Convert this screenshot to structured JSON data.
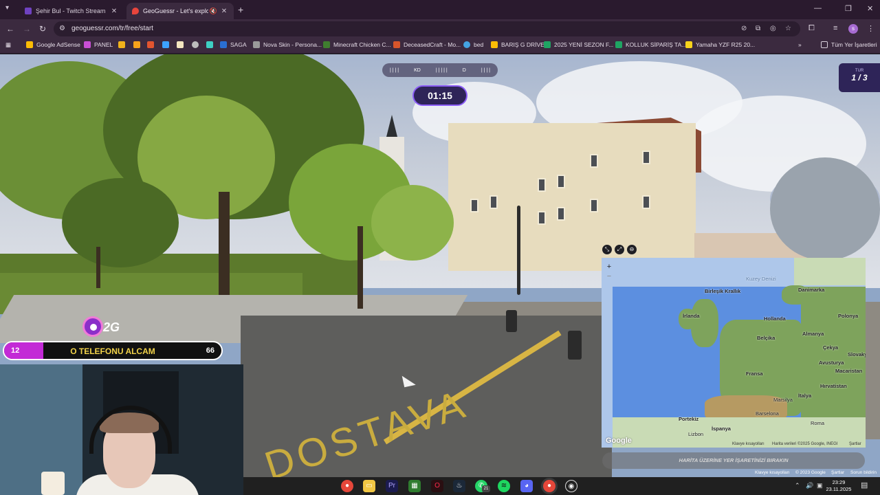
{
  "browser": {
    "tabs": [
      {
        "title": "Şehir Bul - Twitch Stream Games",
        "active": false,
        "color": "#6f42c1"
      },
      {
        "title": "GeoGuessr - Let's explore the world!",
        "active": true,
        "color": "#e8453c"
      }
    ],
    "new_tab": "+",
    "url": "geoguessr.com/tr/free/start",
    "profile_initial": "s"
  },
  "bookmarks": [
    {
      "label": "Google AdSense",
      "color": "#fbbc05"
    },
    {
      "label": "PANEL",
      "color": "#c94fd6"
    },
    {
      "label": "",
      "color": "#f1b21b"
    },
    {
      "label": "",
      "color": "#f7a21b"
    },
    {
      "label": "",
      "color": "#e2552f"
    },
    {
      "label": "",
      "color": "#3ca2ff"
    },
    {
      "label": "",
      "color": "#f4e6c0"
    },
    {
      "label": "",
      "color": "#bdbdbd"
    },
    {
      "label": "",
      "color": "#3ed0c3"
    },
    {
      "label": "SAGA",
      "color": "#2a6fd1"
    },
    {
      "label": "Nova Skin - Persona...",
      "color": "#9a9a9a"
    },
    {
      "label": "Minecraft Chicken C...",
      "color": "#3f7e2f"
    },
    {
      "label": "DeceasedCraft - Mo...",
      "color": "#d8552b"
    },
    {
      "label": "bed",
      "color": "#44a3e2"
    },
    {
      "label": "BARIŞ G DRİVE",
      "color": "#fbbc05"
    },
    {
      "label": "2025 YENİ SEZON F...",
      "color": "#1fa463"
    },
    {
      "label": "KOLLUK SİPARİŞ TA...",
      "color": "#1fa463"
    },
    {
      "label": "Yamaha YZF R25 20...",
      "color": "#f7d31b"
    }
  ],
  "bookmarks_all": "Tüm Yer İşaretleri",
  "game": {
    "compass_labels": [
      "KD",
      "D"
    ],
    "timer": "01:15",
    "round_label": "TUR",
    "round_value": "1 / 3",
    "map_labels": [
      "Kuzey Denizi",
      "Birleşik Krallık",
      "İrlanda",
      "Danimarka",
      "Hollanda",
      "Polonya",
      "Belçika",
      "Almanya",
      "Çekya",
      "Slovakya",
      "Fransa",
      "Avusturya",
      "Macaristan",
      "Hırvatistan",
      "Marsilya",
      "İtalya",
      "Barselona",
      "Portekiz",
      "İspanya",
      "Lizbon",
      "Roma"
    ],
    "map_footer": {
      "shortcuts": "Klavye kısayolları",
      "data": "Harita verileri ©2025 Google, INEGI",
      "terms": "Şartlar",
      "google": "Google"
    },
    "guess_button": "HARİTA ÜZERİNE YER İŞARETİNİZİ BIRAKIN",
    "sv_footer": [
      "Klavye kısayolları",
      "© 2023 Google",
      "Şartlar",
      "Sorun bildirin"
    ],
    "road_text": "DOSTAVA"
  },
  "stream": {
    "overlay_logo": "2G",
    "poll": {
      "left": "12",
      "middle": "O TELEFONU ALCAM",
      "right": "66",
      "fill_fraction": 0.18,
      "fill_color": "#c32ad6"
    }
  },
  "taskbar": {
    "apps": [
      "Chrome",
      "Files",
      "Premiere",
      "Minecraft",
      "Opera GX",
      "Steam",
      "WhatsApp",
      "Spotify",
      "Discord",
      "Chrome",
      "OBS"
    ],
    "whatsapp_badge": "21",
    "time": "23:29",
    "date": "23.11.2025"
  }
}
